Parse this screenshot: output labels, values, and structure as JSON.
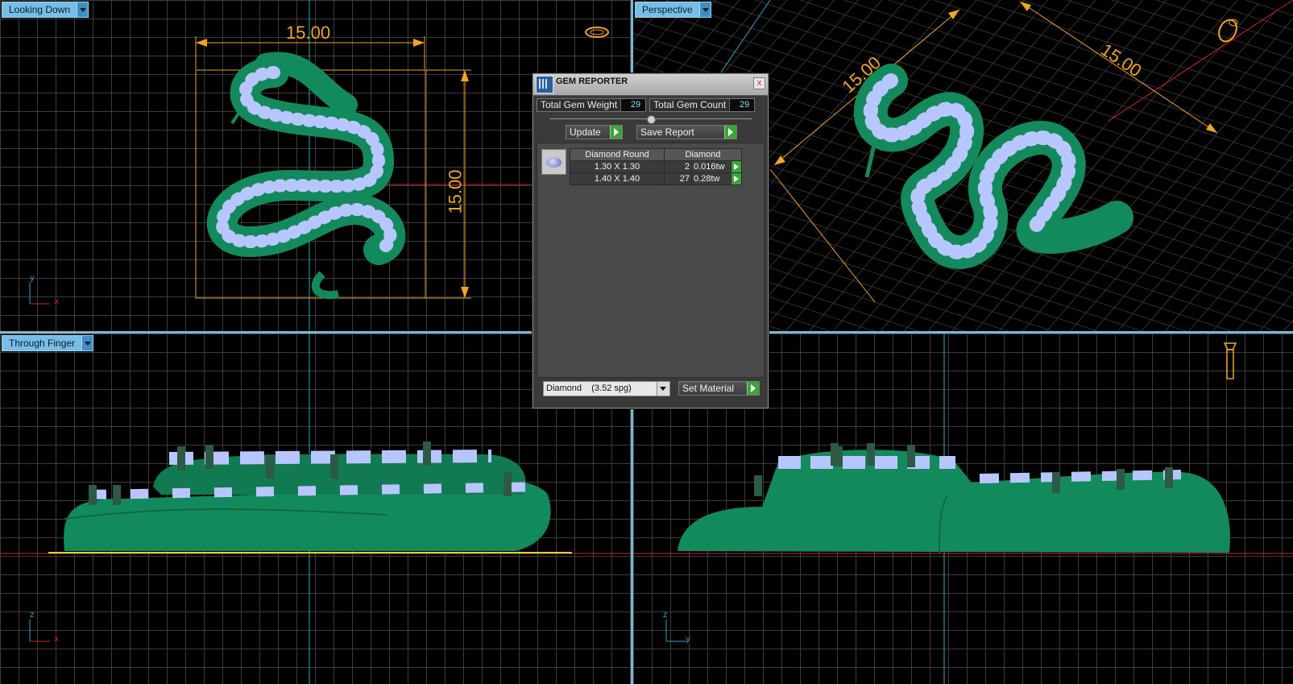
{
  "viewports": {
    "top_left": {
      "label": "Looking Down",
      "dim_h": "15.00",
      "dim_v": "15.00",
      "axis_a": "y",
      "axis_b": "x"
    },
    "top_right": {
      "label": "Perspective",
      "dim_a": "15.00",
      "dim_b": "15.00"
    },
    "bottom_left": {
      "label": "Through Finger",
      "axis_a": "z",
      "axis_b": "x"
    },
    "bottom_right": {
      "axis_a": "z",
      "axis_b": "y"
    }
  },
  "gem_reporter": {
    "title": "GEM REPORTER",
    "close_glyph": "x",
    "total_weight_label": "Total Gem Weight",
    "total_weight_value": "29",
    "total_count_label": "Total Gem Count",
    "total_count_value": "29",
    "update_label": "Update",
    "save_report_label": "Save Report",
    "table": {
      "headers": [
        "Diamond Round",
        "Diamond"
      ],
      "rows": [
        {
          "size": "1.30 X 1.30",
          "count": "2",
          "weight": "0.016tw"
        },
        {
          "size": "1.40 X 1.40",
          "count": "27",
          "weight": "0.28tw"
        }
      ]
    },
    "material_select": "Diamond    (3.52 spg)",
    "set_material_label": "Set Material"
  },
  "icons": [
    "ring-top-view-icon",
    "ring-perspective-icon",
    "ring-side-view-icon",
    "gem-round-icon",
    "dropdown-arrow-icon",
    "green-play-icon"
  ],
  "colors": {
    "model_green": "#148a5e",
    "gem_blue": "#b8c6ff",
    "dimension_orange": "#f0a522",
    "axis_red": "#d42020",
    "axis_cyan": "#2aa8c8",
    "grid": "#3d3d3d",
    "tab_blue": "#77bde6"
  }
}
